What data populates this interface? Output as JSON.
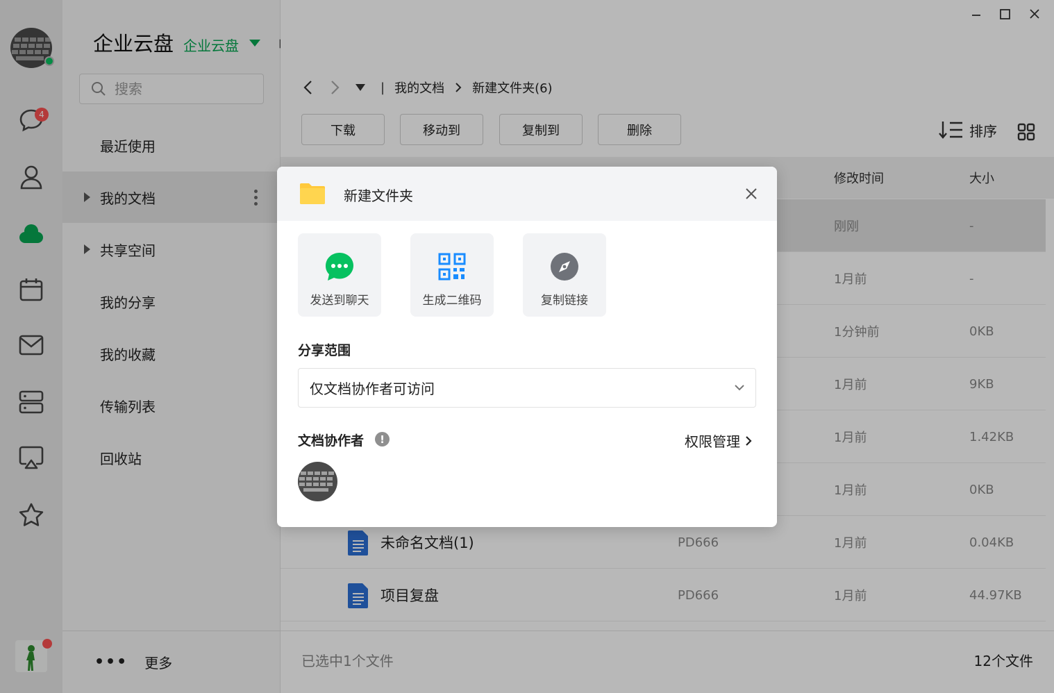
{
  "app": {
    "title": "企业云盘",
    "workspace": "企业云盘",
    "chat_badge": "4",
    "accent": "#07c160"
  },
  "rail": {
    "icons": [
      "chat-icon",
      "contacts-icon",
      "cloud-drive-icon",
      "calendar-icon",
      "mail-icon",
      "server-icon",
      "screen-share-icon",
      "favorite-star-icon"
    ]
  },
  "sidebar": {
    "search_placeholder": "搜索",
    "items": [
      {
        "label": "最近使用"
      },
      {
        "label": "我的文档"
      },
      {
        "label": "共享空间"
      },
      {
        "label": "我的分享"
      },
      {
        "label": "我的收藏"
      },
      {
        "label": "传输列表"
      },
      {
        "label": "回收站"
      }
    ],
    "more_label": "更多"
  },
  "breadcrumb": {
    "root": "我的文档",
    "current": "新建文件夹(6)"
  },
  "toolbar": {
    "download": "下载",
    "move_to": "移动到",
    "copy_to": "复制到",
    "delete": "删除",
    "sort": "排序"
  },
  "table": {
    "columns": {
      "time": "修改时间",
      "size": "大小"
    },
    "rows": [
      {
        "name": "",
        "creator": "",
        "time": "刚刚",
        "size": "-"
      },
      {
        "name": "",
        "creator": "",
        "time": "1月前",
        "size": "-"
      },
      {
        "name": "",
        "creator": "",
        "time": "1分钟前",
        "size": "0KB"
      },
      {
        "name": "",
        "creator": "",
        "time": "1月前",
        "size": "9KB"
      },
      {
        "name": "",
        "creator": "",
        "time": "1月前",
        "size": "1.42KB"
      },
      {
        "name": "",
        "creator": "",
        "time": "1月前",
        "size": "0KB"
      },
      {
        "name": "未命名文档(1)",
        "creator": "PD666",
        "time": "1月前",
        "size": "0.04KB"
      },
      {
        "name": "项目复盘",
        "creator": "PD666",
        "time": "1月前",
        "size": "44.97KB"
      }
    ]
  },
  "footer": {
    "selected": "已选中1个文件",
    "count": "12个文件"
  },
  "dialog": {
    "title": "新建文件夹",
    "actions": [
      {
        "label": "发送到聊天",
        "icon": "chat-bubble-icon",
        "color": "#07c160"
      },
      {
        "label": "生成二维码",
        "icon": "qr-code-icon",
        "color": "#1a8cff"
      },
      {
        "label": "复制链接",
        "icon": "compass-link-icon",
        "color": "#7a7a7a"
      }
    ],
    "scope_title": "分享范围",
    "scope_value": "仅文档协作者可访问",
    "collab_title": "文档协作者",
    "perm_label": "权限管理"
  }
}
